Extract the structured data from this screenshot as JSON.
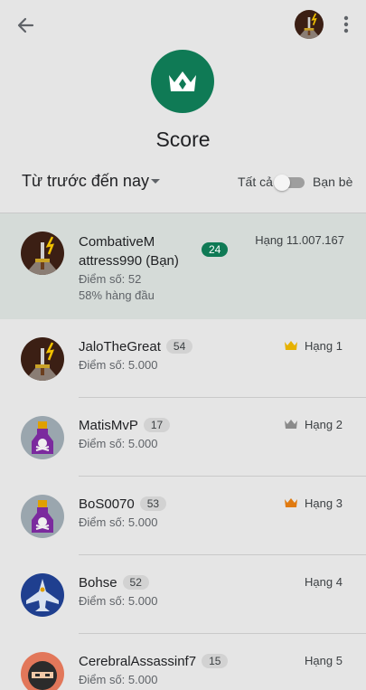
{
  "header": {
    "title": "Score"
  },
  "filter": {
    "label": "Từ trước đến nay"
  },
  "scope": {
    "left_label": "Tất cả",
    "right_label": "Bạn bè",
    "friends_only": false
  },
  "me": {
    "name_line1": "CombativeM",
    "name_line2": "attress990 (Bạn)",
    "level": "24",
    "rank": "Hạng 11.007.167",
    "score": "Điểm số: 52",
    "percentile": "58% hàng đầu"
  },
  "players": [
    {
      "name": "JaloTheGreat",
      "level": "54",
      "score": "Điểm số: 5.000",
      "rank": "Hạng 1",
      "crown_color": "#e6b100",
      "avatar": "sword-icon"
    },
    {
      "name": "MatisMvP",
      "level": "17",
      "score": "Điểm số: 5.000",
      "rank": "Hạng 2",
      "crown_color": "#8a8a8a",
      "avatar": "poison-bottle-icon"
    },
    {
      "name": "BoS0070",
      "level": "53",
      "score": "Điểm số: 5.000",
      "rank": "Hạng 3",
      "crown_color": "#e07a10",
      "avatar": "poison-bottle-icon"
    },
    {
      "name": "Bohse",
      "level": "52",
      "score": "Điểm số: 5.000",
      "rank": "Hạng 4",
      "avatar": "fighter-jet-icon"
    },
    {
      "name": "CerebralAssassinf7",
      "level": "15",
      "score": "Điểm số: 5.000",
      "rank": "Hạng 5",
      "avatar": "ninja-icon"
    }
  ],
  "colors": {
    "accent": "#0f7a55",
    "me_row": "#d5dbd8",
    "background": "#e5e5e5"
  }
}
